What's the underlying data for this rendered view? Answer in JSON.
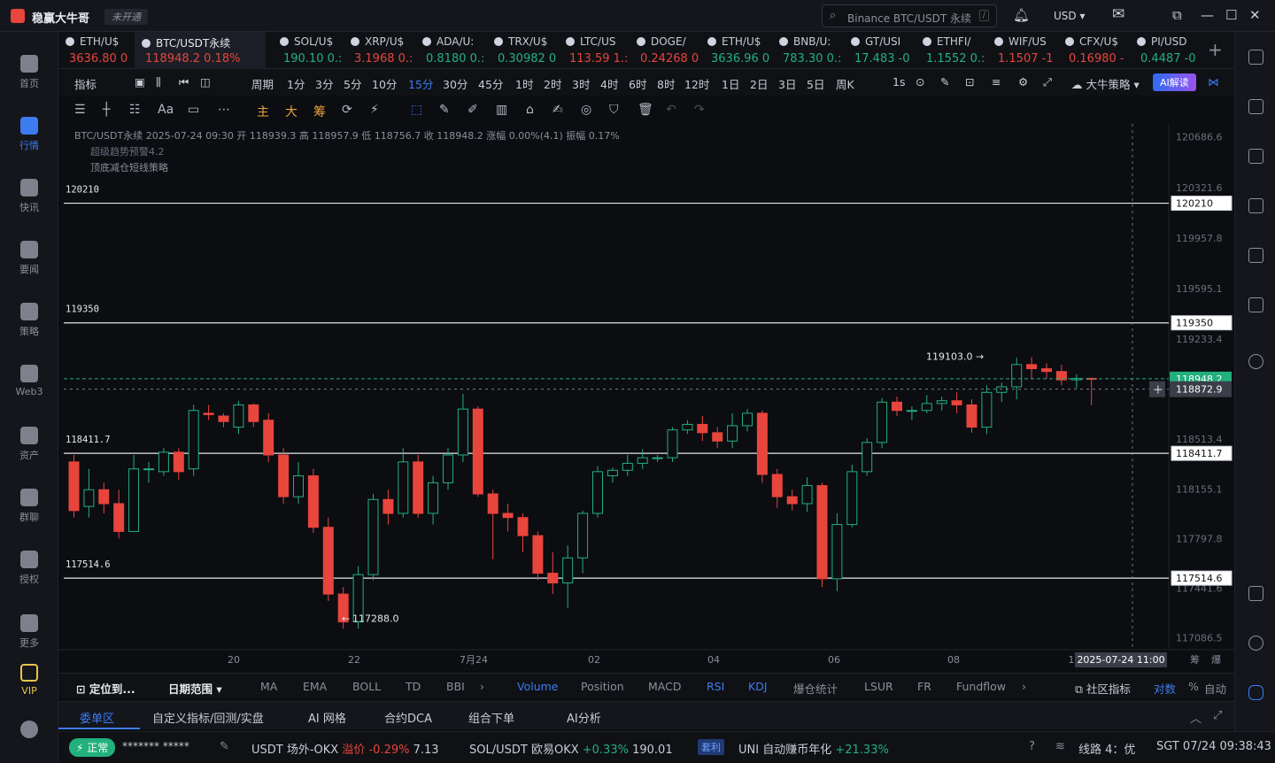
{
  "app": {
    "title": "稳赢大牛哥",
    "account_badge": "未开通",
    "search_placeholder": "Binance BTC/USDT 永续",
    "search_key": "/",
    "currency": "USD"
  },
  "nav": [
    {
      "label": "首页"
    },
    {
      "label": "行情"
    },
    {
      "label": "快讯"
    },
    {
      "label": "要闻"
    },
    {
      "label": "策略"
    },
    {
      "label": "Web3"
    },
    {
      "label": "资产"
    },
    {
      "label": "群聊"
    },
    {
      "label": "授权"
    },
    {
      "label": "更多"
    },
    {
      "label": "VIP"
    }
  ],
  "tickers": [
    {
      "sym": "ETH/U$",
      "price": "3636.80 0",
      "dir": "dn"
    },
    {
      "sym": "BTC/USDT永续",
      "price": "118948.2 0.18%",
      "dir": "dn"
    },
    {
      "sym": "SOL/U$",
      "price": "190.10 0.:",
      "dir": "up"
    },
    {
      "sym": "XRP/U$",
      "price": "3.1968 0.:",
      "dir": "dn"
    },
    {
      "sym": "ADA/U:",
      "price": "0.8180 0.:",
      "dir": "up"
    },
    {
      "sym": "TRX/U$",
      "price": "0.30982 0",
      "dir": "up"
    },
    {
      "sym": "LTC/US",
      "price": "113.59 1.:",
      "dir": "dn"
    },
    {
      "sym": "DOGE/",
      "price": "0.24268 0",
      "dir": "dn"
    },
    {
      "sym": "ETH/U$",
      "price": "3636.96 0",
      "dir": "up"
    },
    {
      "sym": "BNB/U:",
      "price": "783.30 0.:",
      "dir": "up"
    },
    {
      "sym": "GT/USI",
      "price": "17.483 -0",
      "dir": "up"
    },
    {
      "sym": "ETHFI/",
      "price": "1.1552 0.:",
      "dir": "up"
    },
    {
      "sym": "WIF/US",
      "price": "1.1507 -1",
      "dir": "dn"
    },
    {
      "sym": "CFX/U$",
      "price": "0.16980 -",
      "dir": "dn"
    },
    {
      "sym": "PI/USD",
      "price": "0.4487 -0",
      "dir": "up"
    }
  ],
  "periods": [
    "指标",
    "周期",
    "1分",
    "3分",
    "5分",
    "10分",
    "15分",
    "30分",
    "45分",
    "1时",
    "2时",
    "3时",
    "4时",
    "6时",
    "8时",
    "12时",
    "1日",
    "2日",
    "3日",
    "5日",
    "周K",
    "1s"
  ],
  "selected_period": "15分",
  "strategy": "大牛策略",
  "ai_label": "AI解读",
  "draw_tools": [
    "主",
    "大",
    "筹"
  ],
  "chart_header": {
    "line1": "BTC/USDT永续 2025-07-24 09:30 开 118939.3 高 118957.9 低 118756.7 收 118948.2 涨幅 0.00%(4.1) 振幅 0.17%",
    "line2": "超级趋势预警4.2",
    "line3": "顶底减仓短线策略"
  },
  "chart_data": {
    "type": "candlestick",
    "title": "BTC/USDT永续",
    "interval": "15分",
    "y_ticks": [
      120686.6,
      120321.6,
      119957.8,
      119595.1,
      119233.4,
      118872.9,
      118513.4,
      118155.1,
      117797.8,
      117441.6,
      117086.5
    ],
    "ylim": [
      117000,
      120780
    ],
    "x_ticks": [
      "20",
      "22",
      "7月24",
      "02",
      "04",
      "06",
      "08",
      "1"
    ],
    "hlines": [
      120210.0,
      119350.0,
      118411.7,
      117514.6
    ],
    "last_price": 118948.2,
    "crosshair_price": 118872.9,
    "crosshair_time": "2025-07-24 11:00",
    "high_mark": "119103.0",
    "low_mark": "117288.0",
    "candles": [
      [
        118350,
        118000,
        118400,
        117950
      ],
      [
        118030,
        118150,
        118300,
        117950
      ],
      [
        118150,
        118050,
        118200,
        117980
      ],
      [
        118050,
        117850,
        118150,
        117800
      ],
      [
        117850,
        118300,
        118400,
        117850
      ],
      [
        118300,
        118300,
        118350,
        118200
      ],
      [
        118280,
        118420,
        118450,
        118250
      ],
      [
        118420,
        118280,
        118450,
        118220
      ],
      [
        118300,
        118720,
        118760,
        118250
      ],
      [
        118700,
        118690,
        118760,
        118650
      ],
      [
        118680,
        118640,
        118700,
        118600
      ],
      [
        118600,
        118760,
        118790,
        118550
      ],
      [
        118760,
        118640,
        118770,
        118600
      ],
      [
        118650,
        118400,
        118700,
        118350
      ],
      [
        118400,
        118100,
        118450,
        118050
      ],
      [
        118100,
        118250,
        118350,
        118050
      ],
      [
        118250,
        117880,
        118300,
        117840
      ],
      [
        117880,
        117400,
        117950,
        117350
      ],
      [
        117400,
        117200,
        117450,
        117150
      ],
      [
        117200,
        117540,
        117600,
        117150
      ],
      [
        117540,
        118080,
        118120,
        117500
      ],
      [
        118080,
        117980,
        118150,
        117900
      ],
      [
        117980,
        118350,
        118450,
        117950
      ],
      [
        118350,
        117980,
        118400,
        117950
      ],
      [
        117980,
        118200,
        118250,
        117900
      ],
      [
        118200,
        118400,
        118450,
        118150
      ],
      [
        118400,
        118730,
        118840,
        118350
      ],
      [
        118730,
        118120,
        118750,
        118100
      ],
      [
        118120,
        117980,
        118150,
        117650
      ],
      [
        117980,
        117950,
        118050,
        117850
      ],
      [
        117950,
        117820,
        117980,
        117700
      ],
      [
        117820,
        117550,
        117850,
        117500
      ],
      [
        117550,
        117480,
        117700,
        117400
      ],
      [
        117480,
        117660,
        117750,
        117300
      ],
      [
        117660,
        117980,
        118000,
        117550
      ],
      [
        117980,
        118280,
        118320,
        117950
      ],
      [
        118250,
        118290,
        118310,
        118200
      ],
      [
        118290,
        118340,
        118400,
        118250
      ],
      [
        118340,
        118380,
        118440,
        118300
      ],
      [
        118380,
        118380,
        118400,
        118350
      ],
      [
        118380,
        118580,
        118600,
        118350
      ],
      [
        118580,
        118620,
        118650,
        118550
      ],
      [
        118620,
        118560,
        118680,
        118500
      ],
      [
        118560,
        118500,
        118600,
        118450
      ],
      [
        118500,
        118610,
        118700,
        118450
      ],
      [
        118610,
        118700,
        118730,
        118570
      ],
      [
        118700,
        118260,
        118720,
        118200
      ],
      [
        118260,
        118100,
        118300,
        118020
      ],
      [
        118100,
        118050,
        118150,
        118000
      ],
      [
        118050,
        118180,
        118240,
        117990
      ],
      [
        118180,
        117510,
        118200,
        117450
      ],
      [
        117510,
        117900,
        117980,
        117420
      ],
      [
        117900,
        118280,
        118330,
        117880
      ],
      [
        118280,
        118490,
        118520,
        118250
      ],
      [
        118490,
        118780,
        118810,
        118450
      ],
      [
        118780,
        118720,
        118820,
        118680
      ],
      [
        118720,
        118720,
        118750,
        118650
      ],
      [
        118720,
        118770,
        118830,
        118700
      ],
      [
        118770,
        118790,
        118820,
        118720
      ],
      [
        118790,
        118760,
        118850,
        118700
      ],
      [
        118760,
        118600,
        118800,
        118560
      ],
      [
        118600,
        118850,
        118900,
        118550
      ],
      [
        118850,
        118890,
        118920,
        118780
      ],
      [
        118890,
        119050,
        119100,
        118800
      ],
      [
        119050,
        119020,
        119103,
        118950
      ],
      [
        119020,
        119000,
        119060,
        118950
      ],
      [
        119000,
        118940,
        119050,
        118900
      ],
      [
        118940,
        118950,
        118980,
        118880
      ],
      [
        118950,
        118948,
        118958,
        118757
      ]
    ]
  },
  "indicators": {
    "locate": "定位到...",
    "range": "日期范围",
    "items": [
      "MA",
      "EMA",
      "BOLL",
      "TD",
      "BBI",
      "Volume",
      "Position",
      "MACD",
      "RSI",
      "KDJ",
      "爆仓统计",
      "LSUR",
      "FR",
      "Fundflow"
    ],
    "community": "社区指标",
    "compare": "对数",
    "pct": "%",
    "auto": "自动",
    "right_tools": [
      "筹",
      "爆"
    ]
  },
  "bottom_tabs": [
    "委单区",
    "自定义指标/回测/实盘",
    "AI 网格",
    "合约DCA",
    "组合下单",
    "AI分析"
  ],
  "status": {
    "state": "正常",
    "user": "******* *****",
    "items": [
      {
        "label": "USDT 场外-OKX",
        "extra": "溢价 -0.29%",
        "val": "7.13"
      },
      {
        "label": "SOL/USDT 欧易OKX",
        "extra": "+0.33%",
        "val": "190.01"
      }
    ],
    "tag": "套利",
    "uni": "UNI 自动赚币年化",
    "uni_val": "+21.33%",
    "line": "线路 4：优",
    "time": "SGT 07/24 09:38:43"
  }
}
